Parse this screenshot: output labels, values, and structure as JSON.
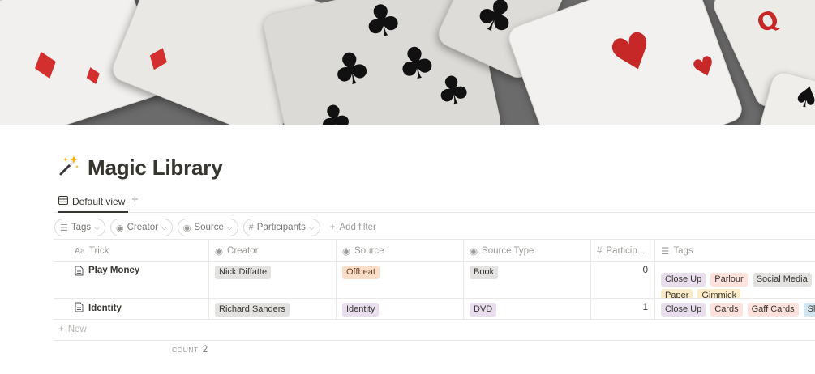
{
  "page": {
    "title": "Magic Library",
    "title_icon": "magic-wand-icon"
  },
  "views": {
    "active_label": "Default view",
    "add_label": "+"
  },
  "filters": {
    "chips": [
      {
        "label": "Tags",
        "icon": "list-icon"
      },
      {
        "label": "Creator",
        "icon": "select-icon"
      },
      {
        "label": "Source",
        "icon": "select-icon"
      },
      {
        "label": "Participants",
        "icon": "number-icon"
      }
    ],
    "add_filter_label": "Add filter"
  },
  "table": {
    "headers": [
      {
        "label": "Trick",
        "icon": "Aa"
      },
      {
        "label": "Creator",
        "icon": "select-icon"
      },
      {
        "label": "Source",
        "icon": "select-icon"
      },
      {
        "label": "Source Type",
        "icon": "select-icon"
      },
      {
        "label": "Particip...",
        "icon": "#"
      },
      {
        "label": "Tags",
        "icon": "list-icon"
      }
    ],
    "rows": [
      {
        "trick": "Play Money",
        "creator": "Nick Diffatte",
        "source": "Offbeat",
        "source_type": "Book",
        "participants": "0",
        "tags": [
          "Close Up",
          "Parlour",
          "Social Media",
          "",
          "Paper",
          "Gimmick"
        ]
      },
      {
        "trick": "Identity",
        "creator": "Richard Sanders",
        "source": "Identity",
        "source_type": "DVD",
        "participants": "1",
        "tags": [
          "Close Up",
          "Cards",
          "Gaff Cards",
          "Sha"
        ]
      }
    ],
    "new_label": "New",
    "count_label": "COUNT",
    "count_value": "2"
  },
  "colors": {
    "gray_tag": "#e3e2e0",
    "orange_tag": "#fadec9",
    "purple_tag": "#e8deee",
    "red_tag": "#ffe2dd",
    "yellow_tag": "#fdecc8",
    "blue_tag": "#d3e5ef"
  }
}
